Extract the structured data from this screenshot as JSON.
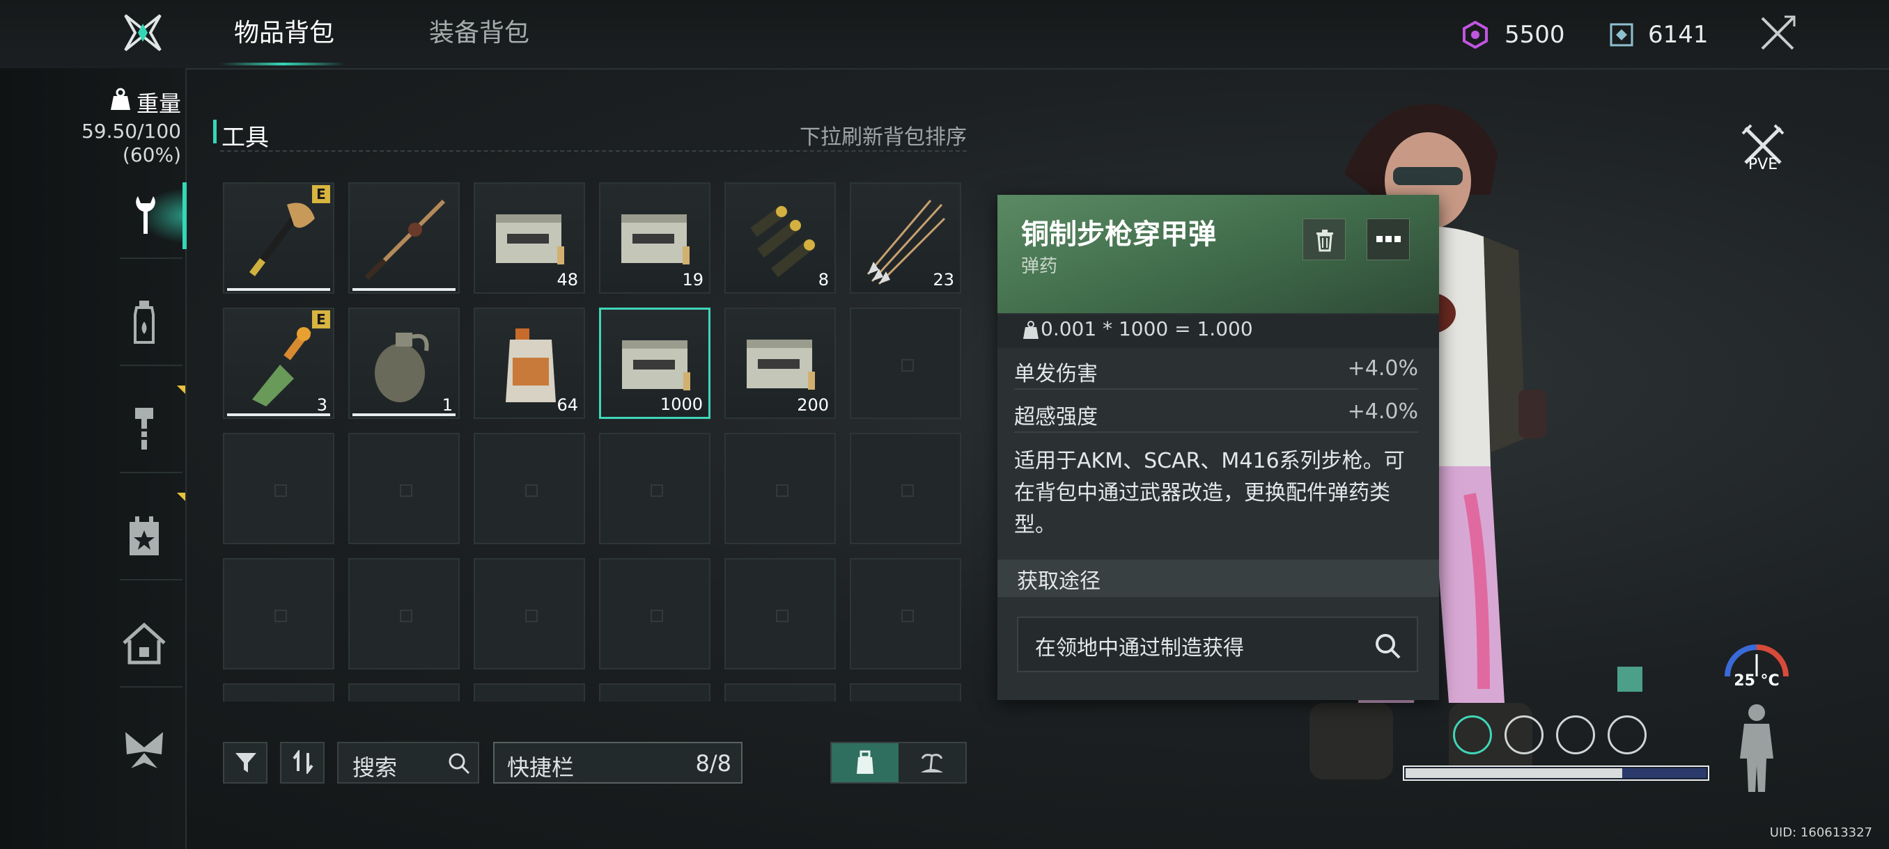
{
  "header": {
    "tabs": [
      {
        "label": "物品背包",
        "active": true
      },
      {
        "label": "装备背包",
        "active": false
      }
    ],
    "currency": [
      {
        "icon": "crystal-icon",
        "value": "5500"
      },
      {
        "icon": "token-icon",
        "value": "6141"
      }
    ],
    "accent_color": "#35d6b6"
  },
  "sidebar": {
    "weight_label": "重量",
    "weight_value": "59.50/100",
    "weight_percent": "(60%)",
    "items": [
      {
        "icon": "wrench-icon",
        "active": true
      },
      {
        "icon": "bottle-icon",
        "active": false
      },
      {
        "icon": "hammer-icon",
        "active": false
      },
      {
        "icon": "calendar-star-icon",
        "active": false
      },
      {
        "icon": "house-icon",
        "active": false
      },
      {
        "icon": "butterfly-icon",
        "active": false
      }
    ]
  },
  "inventory": {
    "section_title": "工具",
    "sort_hint": "下拉刷新背包排序",
    "slots": [
      {
        "icon": "axe-icon",
        "qty": "",
        "badge": "E",
        "durability": 1.0
      },
      {
        "icon": "fishing-rod-icon",
        "qty": "",
        "badge": "",
        "durability": 1.0
      },
      {
        "icon": "ammo-box-icon",
        "qty": "48",
        "badge": ""
      },
      {
        "icon": "ammo-box-icon",
        "qty": "19",
        "badge": ""
      },
      {
        "icon": "shotgun-shells-icon",
        "qty": "8",
        "badge": ""
      },
      {
        "icon": "arrows-icon",
        "qty": "23",
        "badge": ""
      },
      {
        "icon": "molotov-icon",
        "qty": "3",
        "badge": "E",
        "durability": 1.0
      },
      {
        "icon": "grenade-icon",
        "qty": "1",
        "badge": "",
        "durability": 1.0
      },
      {
        "icon": "fuel-can-icon",
        "qty": "64",
        "badge": ""
      },
      {
        "icon": "ammo-box-icon",
        "qty": "1000",
        "badge": "",
        "selected": true
      },
      {
        "icon": "ammo-box-icon",
        "qty": "200",
        "badge": ""
      }
    ],
    "filter_icon": "filter-icon",
    "sort_icon": "sort-icon",
    "search_label": "搜索",
    "quickbar_label": "快捷栏",
    "quickbar_count": "8/8"
  },
  "detail": {
    "name": "铜制步枪穿甲弹",
    "type": "弹药",
    "weight_formula": "0.001 * 1000 = 1.000",
    "stats": [
      {
        "name": "单发伤害",
        "value": "+4.0%"
      },
      {
        "name": "超感强度",
        "value": "+4.0%"
      }
    ],
    "description": "适用于AKM、SCAR、M416系列步枪。可在背包中通过武器改造，更换配件弹药类型。",
    "source_title": "获取途径",
    "source_text": "在领地中通过制造获得"
  },
  "hud": {
    "mode": "PVE",
    "temperature": "25 °C",
    "stamina": 0.72,
    "uid": "UID: 160613327"
  }
}
